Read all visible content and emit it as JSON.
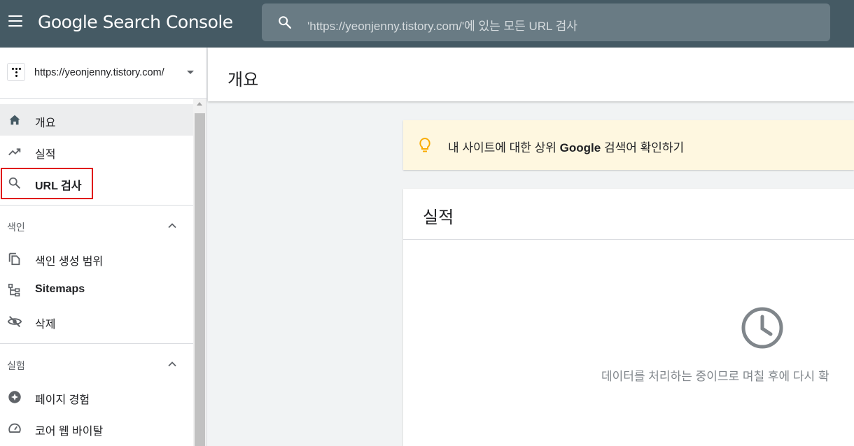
{
  "app": {
    "title": "Google Search Console",
    "menu_icon": "hamburger-menu-icon"
  },
  "search": {
    "placeholder": "'https://yeonjenny.tistory.com/'에 있는 모든 URL 검사",
    "icon": "search-icon"
  },
  "property": {
    "url": "https://yeonjenny.tistory.com/",
    "icon": "tistory-logo-icon"
  },
  "sidebar": {
    "items": [
      {
        "label": "개요",
        "icon": "home-icon",
        "active": true
      },
      {
        "label": "실적",
        "icon": "trending-up-icon"
      },
      {
        "label": "URL 검사",
        "icon": "search-icon"
      }
    ],
    "sections": [
      {
        "label": "색인",
        "items": [
          {
            "label": "색인 생성 범위",
            "icon": "copy-icon"
          },
          {
            "label": "Sitemaps",
            "icon": "sitemap-icon"
          },
          {
            "label": "삭제",
            "icon": "visibility-off-icon"
          }
        ]
      },
      {
        "label": "실험",
        "items": [
          {
            "label": "페이지 경험",
            "icon": "star-badge-icon"
          },
          {
            "label": "코어 웹 바이탈",
            "icon": "speedometer-icon"
          }
        ]
      }
    ]
  },
  "main": {
    "page_title": "개요",
    "tip": {
      "prefix": "내 사이트에 대한 상위 ",
      "bold": "Google",
      "suffix": " 검색어 확인하기",
      "icon": "lightbulb-icon"
    },
    "performance_card": {
      "title": "실적",
      "status": "데이터를 처리하는 중이므로 며칠 후에 다시 확",
      "icon": "clock-icon"
    }
  },
  "colors": {
    "topbar": "#455a64",
    "search_bg": "#697b84",
    "tip_bg": "#fef7e0",
    "highlight": "#e00000",
    "bulb": "#f9ab00"
  }
}
